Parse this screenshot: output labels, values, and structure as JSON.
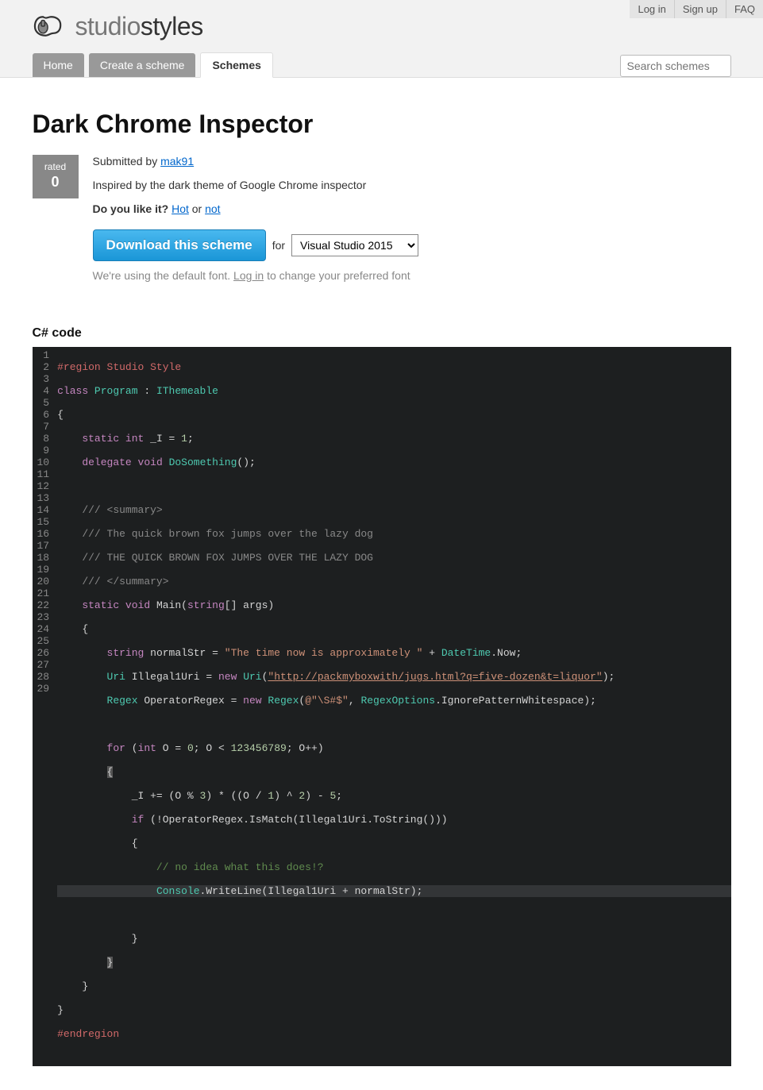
{
  "util": {
    "login": "Log in",
    "signup": "Sign up",
    "faq": "FAQ"
  },
  "brand": {
    "a": "studio",
    "b": "styles"
  },
  "nav": {
    "home": "Home",
    "create": "Create a scheme",
    "schemes": "Schemes"
  },
  "search": {
    "placeholder": "Search schemes"
  },
  "page": {
    "title": "Dark Chrome Inspector",
    "rating_label": "rated",
    "rating_value": "0",
    "submitted_prefix": "Submitted by ",
    "author": "mak91",
    "description": "Inspired by the dark theme of Google Chrome inspector",
    "like_q": "Do you like it?",
    "hot": "Hot",
    "or": " or ",
    "not": "not",
    "download_btn": "Download this scheme",
    "for": "for",
    "vs_option": "Visual Studio 2015",
    "font_note_a": "We're using the default font. ",
    "font_note_login": "Log in",
    "font_note_b": " to change your preferred font",
    "code_heading": "C# code"
  },
  "code": {
    "lines": 29,
    "l1": "#region Studio Style",
    "l2a": "class ",
    "l2b": "Program",
    "l2c": " : ",
    "l2d": "IThemeable",
    "l3": "{",
    "l4a": "    ",
    "l4b": "static int",
    "l4c": " _I = ",
    "l4d": "1",
    "l4e": ";",
    "l5a": "    ",
    "l5b": "delegate void",
    "l5c": " ",
    "l5d": "DoSomething",
    "l5e": "();",
    "l6": "",
    "l7": "    /// <summary>",
    "l8": "    /// The quick brown fox jumps over the lazy dog",
    "l9": "    /// THE QUICK BROWN FOX JUMPS OVER THE LAZY DOG",
    "l10": "    /// </summary>",
    "l11a": "    ",
    "l11b": "static void",
    "l11c": " Main(",
    "l11d": "string",
    "l11e": "[] args)",
    "l12": "    {",
    "l13a": "        ",
    "l13b": "string",
    "l13c": " normalStr = ",
    "l13d": "\"The time now is approximately \"",
    "l13e": " + ",
    "l13f": "DateTime",
    "l13g": ".Now;",
    "l14a": "        ",
    "l14b": "Uri",
    "l14c": " Illegal1Uri = ",
    "l14d": "new ",
    "l14e": "Uri",
    "l14f": "(",
    "l14g": "\"http://packmyboxwith/jugs.html?q=five-dozen&t=liquor\"",
    "l14h": ");",
    "l15a": "        ",
    "l15b": "Regex",
    "l15c": " OperatorRegex = ",
    "l15d": "new ",
    "l15e": "Regex",
    "l15f": "(",
    "l15g": "@\"\\S#$\"",
    "l15h": ", ",
    "l15i": "RegexOptions",
    "l15j": ".IgnorePatternWhitespace);",
    "l16": "",
    "l17a": "        ",
    "l17b": "for",
    "l17c": " (",
    "l17d": "int",
    "l17e": " O = ",
    "l17f": "0",
    "l17g": "; O < ",
    "l17h": "123456789",
    "l17i": "; O++)",
    "l18a": "        ",
    "l18b": "{",
    "l19a": "            _I += (O % ",
    "l19b": "3",
    "l19c": ") * ((O / ",
    "l19d": "1",
    "l19e": ") ^ ",
    "l19f": "2",
    "l19g": ") - ",
    "l19h": "5",
    "l19i": ";",
    "l20a": "            ",
    "l20b": "if",
    "l20c": " (!OperatorRegex.IsMatch(Illegal1Uri.ToString()))",
    "l21": "            {",
    "l22": "                // no idea what this does!?",
    "l23a": "                ",
    "l23b": "Console",
    "l23c": ".WriteLine(Illegal1Uri + normalStr);",
    "l24": "",
    "l25": "            }",
    "l26a": "        ",
    "l26b": "}",
    "l27": "    }",
    "l28": "}",
    "l29": "#endregion"
  }
}
